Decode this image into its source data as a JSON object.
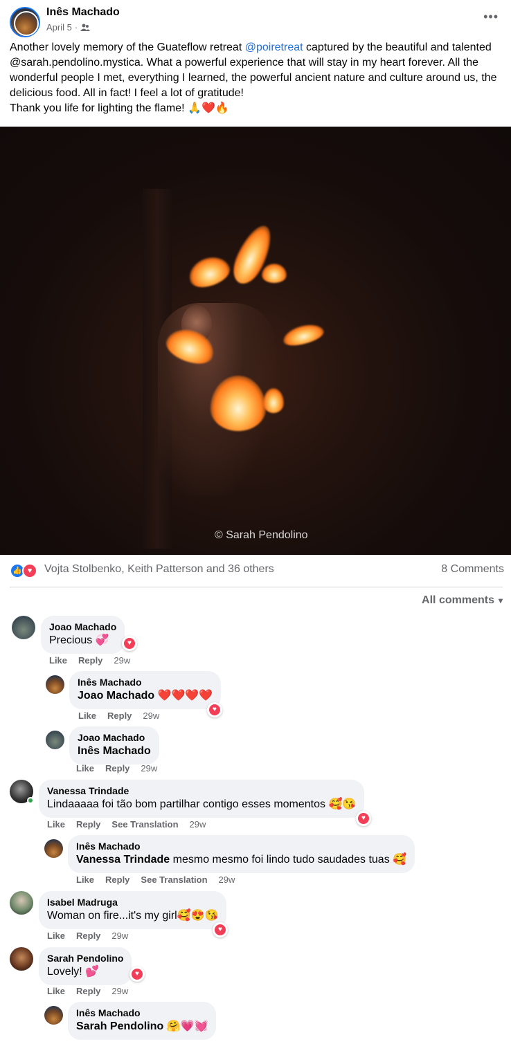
{
  "post": {
    "author": "Inês Machado",
    "date": "April 5",
    "audience_separator": "·",
    "audience_icon": "friends-icon",
    "more_icon": "•••",
    "caption_before": "Another lovely memory of the Guateflow retreat ",
    "caption_mention": "@poiretreat",
    "caption_after": " captured by the beautiful and talented @sarah.pendolino.mystica. What a powerful experience that will stay in my heart forever. All the wonderful people I met, everything I learned, the powerful ancient nature and culture around us, the delicious food. All in fact! I feel a lot of gratitude!\nThank you life for lighting the flame! 🙏❤️🔥",
    "photo_watermark": "© Sarah Pendolino"
  },
  "reactions": {
    "names": "Vojta Stolbenko, Keith Patterson and 36 others",
    "comments": "8 Comments",
    "like_glyph": "👍",
    "love_glyph": "♥"
  },
  "sort": {
    "label": "All comments",
    "caret": "▾"
  },
  "labels": {
    "like": "Like",
    "reply": "Reply",
    "see_translation": "See Translation",
    "heart": "♥"
  },
  "comments": [
    {
      "name": "Joao Machado",
      "text": "Precious 💞",
      "time": "29w"
    },
    {
      "name": "Inês Machado",
      "mention": "Joao Machado",
      "text": " ❤️❤️❤️❤️",
      "time": "29w"
    },
    {
      "name": "Joao Machado",
      "mention": "Inês Machado",
      "text": "",
      "time": "29w"
    },
    {
      "name": "Vanessa Trindade",
      "text": "Lindaaaaa foi tão bom partilhar contigo esses momentos 🥰😘",
      "time": "29w"
    },
    {
      "name": "Inês Machado",
      "mention": "Vanessa Trindade",
      "text": " mesmo mesmo foi lindo tudo saudades tuas 🥰",
      "time": "29w"
    },
    {
      "name": "Isabel Madruga",
      "text": "Woman on fire...it's my girl🥰😍😘",
      "time": "29w"
    },
    {
      "name": "Sarah Pendolino",
      "text": "Lovely! 💕",
      "time": "29w"
    },
    {
      "name": "Inês Machado",
      "mention": "Sarah Pendolino",
      "text": " 🤗💗💓",
      "time": "29w"
    }
  ]
}
